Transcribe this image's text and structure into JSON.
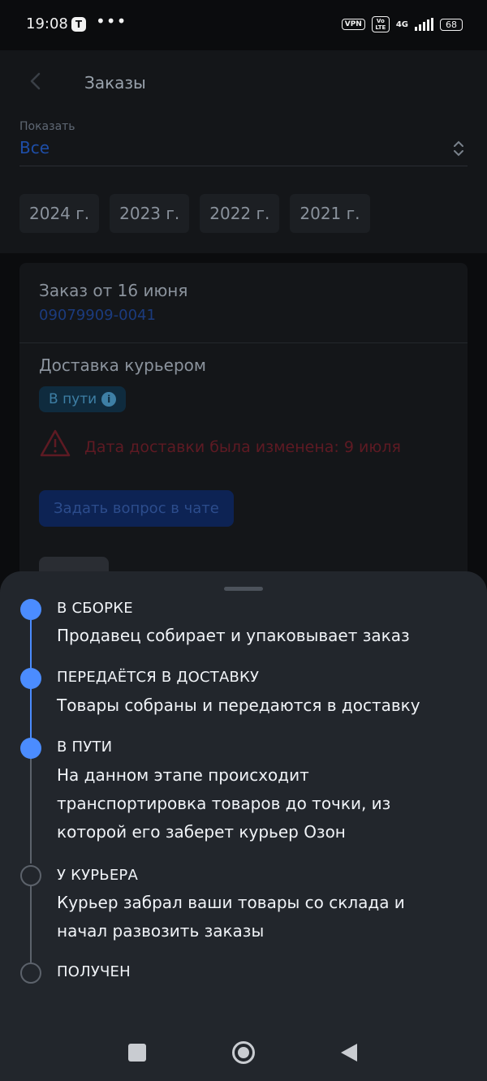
{
  "status_bar": {
    "time": "19:08",
    "app_badge": "T",
    "more": "•••",
    "vpn": "VPN",
    "volte": "Vo LTE",
    "network": "4G",
    "battery": "68"
  },
  "header": {
    "title": "Заказы"
  },
  "filter": {
    "label": "Показать",
    "value": "Все"
  },
  "years": [
    "2024 г.",
    "2023 г.",
    "2022 г.",
    "2021 г."
  ],
  "order": {
    "title": "Заказ от 16 июня",
    "number": "09079909-0041",
    "delivery_type": "Доставка курьером",
    "status": "В пути",
    "warning": "Дата доставки была изменена: 9 июля",
    "chat_button": "Задать вопрос в чате"
  },
  "timeline": {
    "steps": [
      {
        "title": "В СБОРКЕ",
        "description": "Продавец собирает и упаковывает заказ",
        "done": true
      },
      {
        "title": "ПЕРЕДАЁТСЯ В ДОСТАВКУ",
        "description": "Товары собраны и передаются в доставку",
        "done": true
      },
      {
        "title": "В ПУТИ",
        "description": "На данном этапе происходит транспортировка товаров до точки, из которой его заберет курьер Озон",
        "done": true
      },
      {
        "title": "У КУРЬЕРА",
        "description": "Курьер забрал ваши товары со склада и начал развозить заказы",
        "done": false
      },
      {
        "title": "ПОЛУЧЕН",
        "description": "",
        "done": false
      }
    ]
  },
  "colors": {
    "accent": "#4b8cff",
    "sheet": "#22262c",
    "inactive": "#5c626b"
  }
}
